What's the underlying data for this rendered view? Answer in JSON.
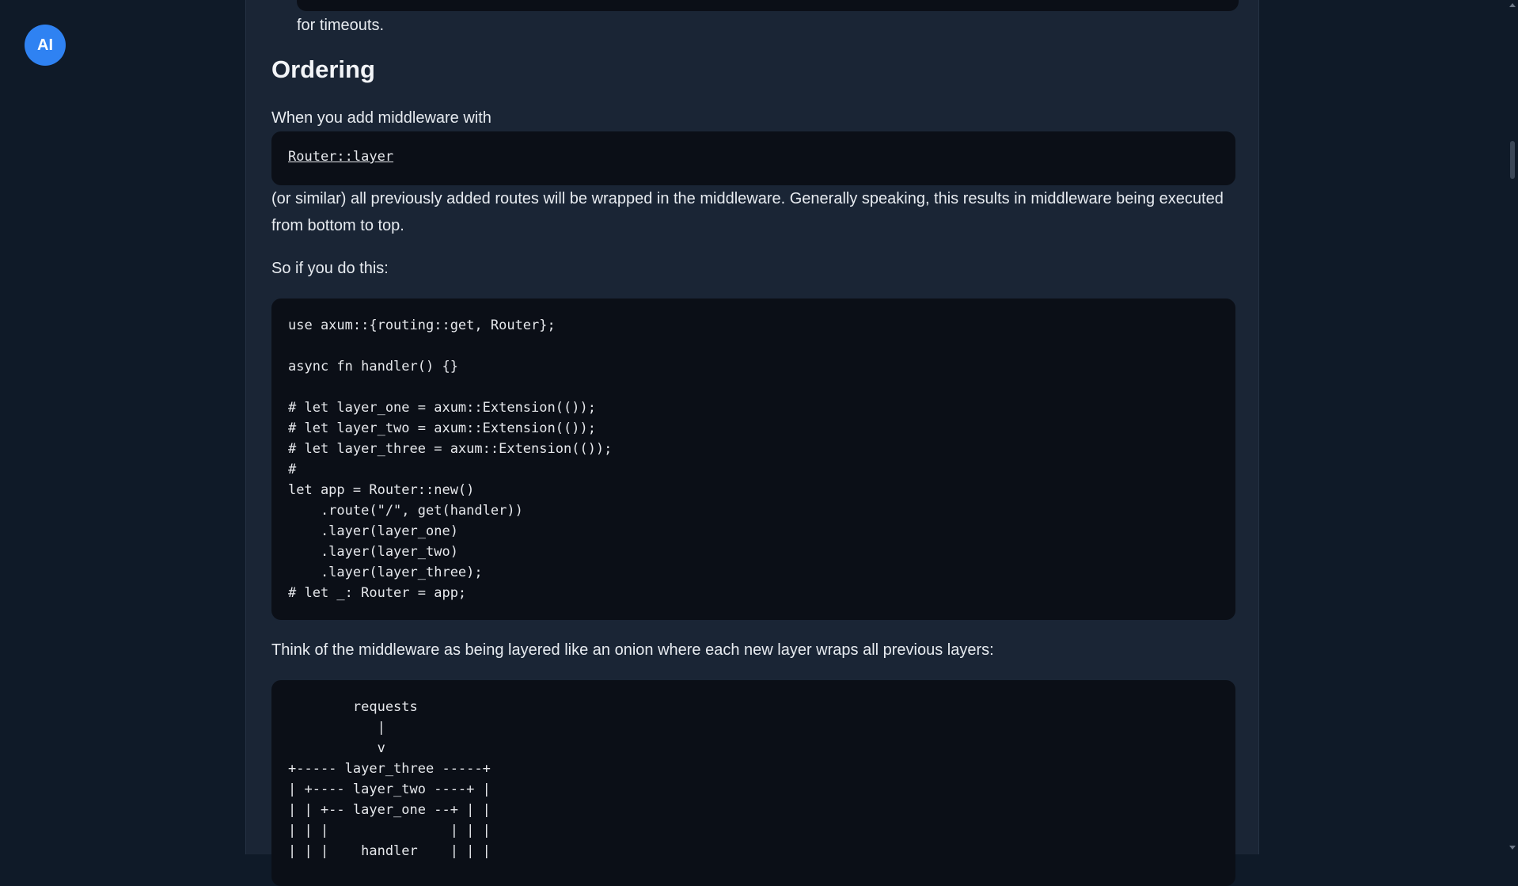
{
  "avatar": {
    "initials": "AI"
  },
  "article": {
    "prev_tail_text": "for timeouts.",
    "heading": "Ordering",
    "intro_text": "When you add middleware with",
    "inline_code_link": "Router::layer",
    "para_similar": "(or similar) all previously added routes will be wrapped in the middleware. Generally speaking, this results in middleware being executed from bottom to top.",
    "para_so": "So if you do this:",
    "code_example": "use axum::{routing::get, Router};\n\nasync fn handler() {}\n\n# let layer_one = axum::Extension(());\n# let layer_two = axum::Extension(());\n# let layer_three = axum::Extension(());\n#\nlet app = Router::new()\n    .route(\"/\", get(handler))\n    .layer(layer_one)\n    .layer(layer_two)\n    .layer(layer_three);\n# let _: Router = app;",
    "para_onion": "Think of the middleware as being layered like an onion where each new layer wraps all previous layers:",
    "diagram_code": "        requests\n           |\n           v\n+----- layer_three -----+\n| +---- layer_two ----+ |\n| | +-- layer_one --+ | |\n| | |               | | |\n| | |    handler    | | |"
  },
  "colors": {
    "page_bg": "#0f1a28",
    "panel_bg": "#1a2535",
    "code_bg": "#0b0f17",
    "avatar_bg": "#2f82f2"
  }
}
